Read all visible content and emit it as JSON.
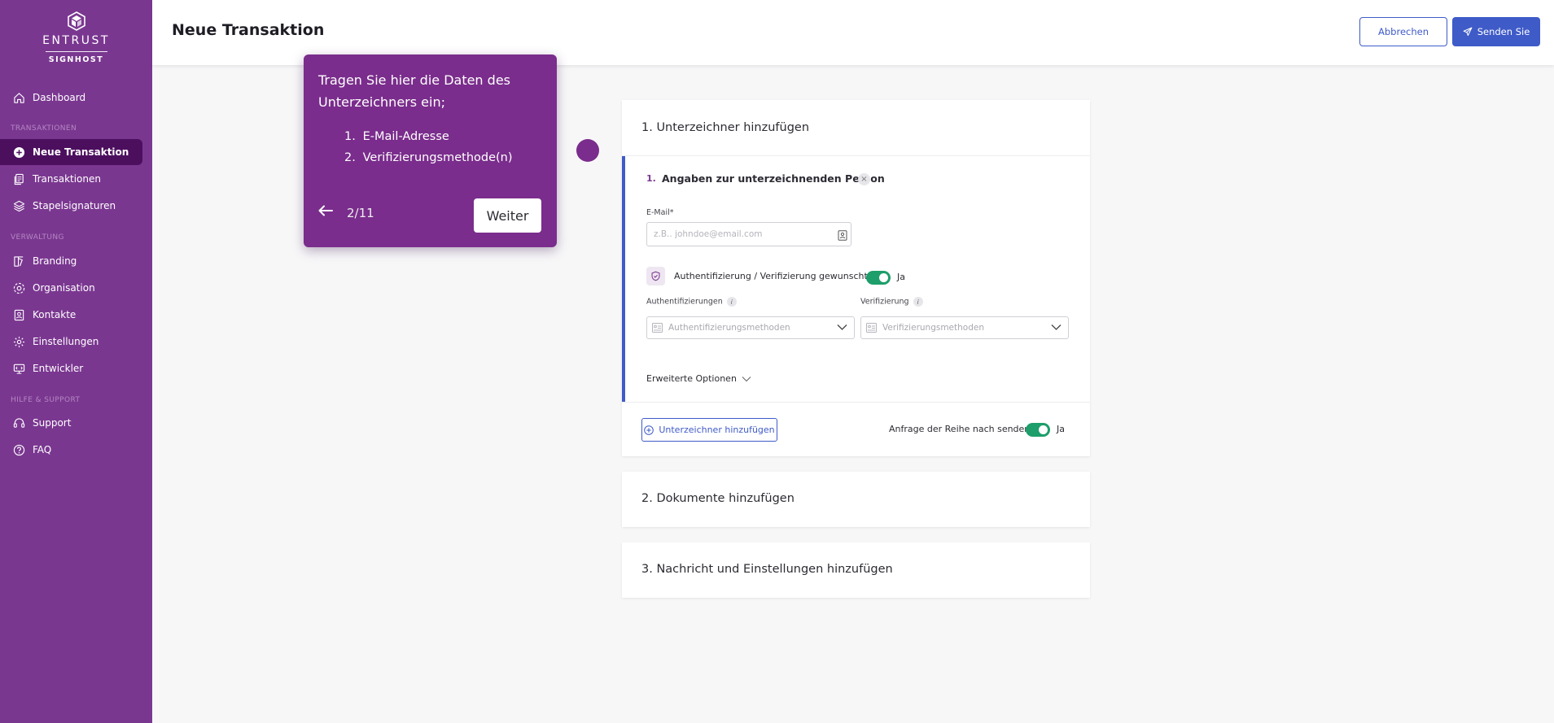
{
  "brand": {
    "name": "ENTRUST",
    "product": "SIGNHOST"
  },
  "colors": {
    "sidebar": "#7a3790",
    "sidebar_active": "#4c0f5e",
    "primary": "#3f5bc8",
    "toggle_on": "#1d9e6a",
    "tour": "#7a2d8c"
  },
  "sidebar": {
    "dashboard": {
      "label": "Dashboard",
      "icon": "home-icon"
    },
    "section_transactions": "TRANSAKTIONEN",
    "new_transaction": {
      "label": "Neue Transaktion",
      "icon": "plus-circle-icon"
    },
    "transactions": {
      "label": "Transaktionen",
      "icon": "documents-icon"
    },
    "batch": {
      "label": "Stapelsignaturen",
      "icon": "layers-icon"
    },
    "section_admin": "VERWALTUNG",
    "branding": {
      "label": "Branding",
      "icon": "brush-icon"
    },
    "organisation": {
      "label": "Organisation",
      "icon": "organisation-icon"
    },
    "contacts": {
      "label": "Kontakte",
      "icon": "contact-icon"
    },
    "settings": {
      "label": "Einstellungen",
      "icon": "gear-icon"
    },
    "developer": {
      "label": "Entwickler",
      "icon": "developer-icon"
    },
    "section_help": "HILFE & SUPPORT",
    "support": {
      "label": "Support",
      "icon": "support-icon"
    },
    "faq": {
      "label": "FAQ",
      "icon": "question-icon"
    }
  },
  "header": {
    "title": "Neue Transaktion",
    "cancel": "Abbrechen",
    "send": "Senden Sie"
  },
  "step1": {
    "title": "1. Unterzeichner hinzufügen",
    "signer_number": "1.",
    "signer_heading": "Angaben zur unterzeichnenden Person",
    "remove": "×",
    "email_label": "E-Mail*",
    "email_value": "",
    "email_placeholder": "z.B.. johndoe@email.com",
    "auth_question": "Authentifizierung / Verifizierung gewunscht?",
    "auth_toggle": "Ja",
    "auth_label": "Authentifizierungen",
    "auth_placeholder": "Authentifizierungsmethoden",
    "verif_label": "Verifizierung",
    "verif_placeholder": "Verifizierungsmethoden",
    "info": "i",
    "advanced": "Erweiterte Optionen",
    "add_signer": "Unterzeichner hinzufügen",
    "sequence_label": "Anfrage der Reihe nach senden",
    "sequence_toggle": "Ja"
  },
  "step2": {
    "title": "2. Dokumente hinzufügen"
  },
  "step3": {
    "title": "3. Nachricht und Einstellungen hinzufügen"
  },
  "tour": {
    "text": "Tragen Sie hier die Daten des Unterzeichners ein;",
    "items": [
      {
        "n": "1.",
        "label": "E-Mail-Adresse"
      },
      {
        "n": "2.",
        "label": "Verifizierungsmethode(n)"
      }
    ],
    "step": "2/11",
    "next": "Weiter"
  }
}
